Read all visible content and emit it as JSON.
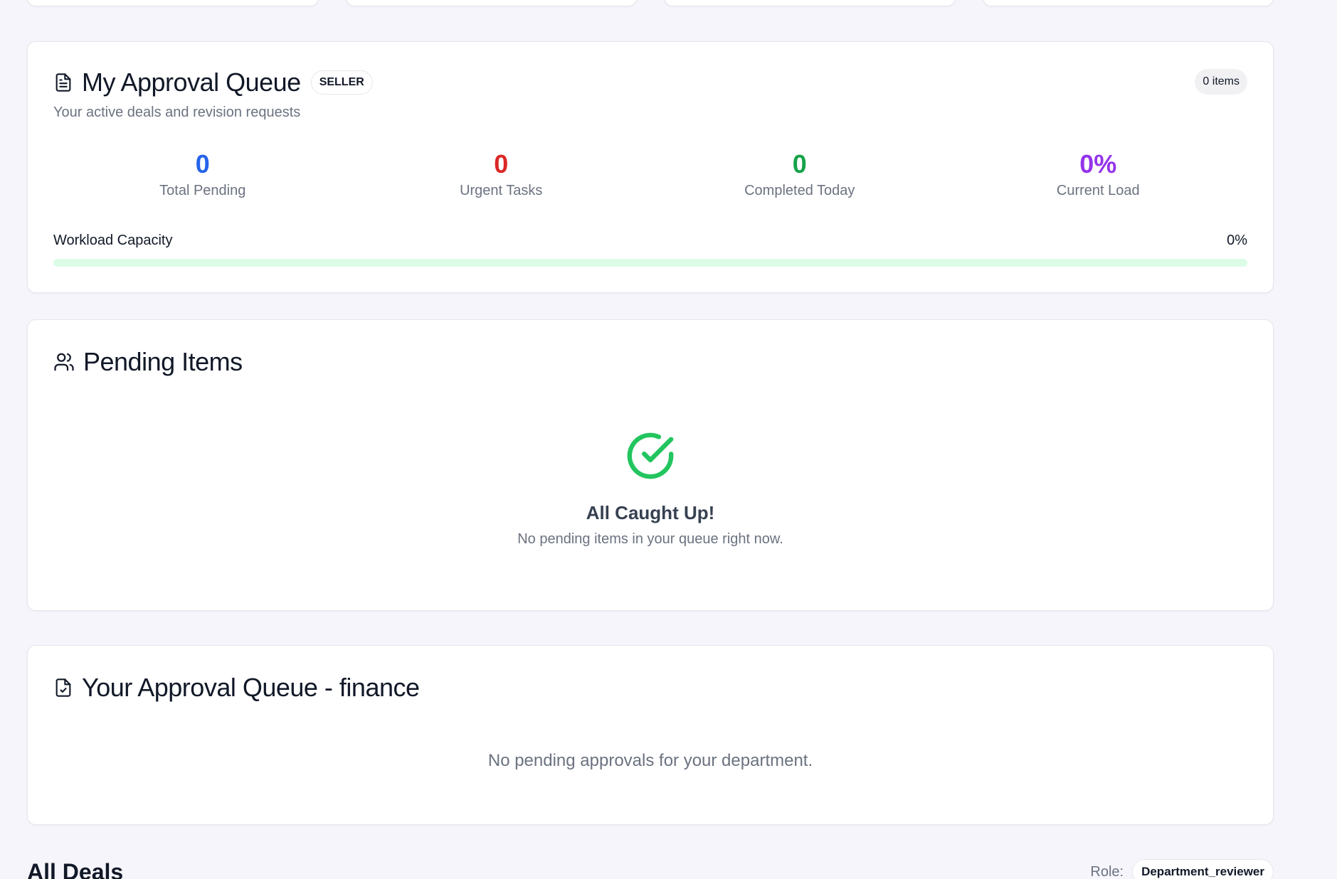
{
  "queue": {
    "title": "My Approval Queue",
    "badge": "SELLER",
    "subtitle": "Your active deals and revision requests",
    "item_count": "0 items",
    "stats": [
      {
        "value": "0",
        "label": "Total Pending",
        "color": "#2563eb"
      },
      {
        "value": "0",
        "label": "Urgent Tasks",
        "color": "#dc2626"
      },
      {
        "value": "0",
        "label": "Completed Today",
        "color": "#16a34a"
      },
      {
        "value": "0%",
        "label": "Current Load",
        "color": "#9333ea"
      }
    ],
    "workload": {
      "label": "Workload Capacity",
      "value_text": "0%",
      "fraction": 0
    }
  },
  "pending": {
    "title": "Pending Items",
    "icon": "users-icon",
    "empty_title": "All Caught Up!",
    "empty_text": "No pending items in your queue right now.",
    "empty_icon": "check-circle-icon",
    "empty_icon_color": "#22c55e"
  },
  "finance": {
    "title": "Your Approval Queue - finance",
    "icon": "file-check-icon",
    "empty_text": "No pending approvals for your department."
  },
  "deals": {
    "title": "All Deals",
    "role_label": "Role:",
    "role_value": "Department_reviewer"
  }
}
